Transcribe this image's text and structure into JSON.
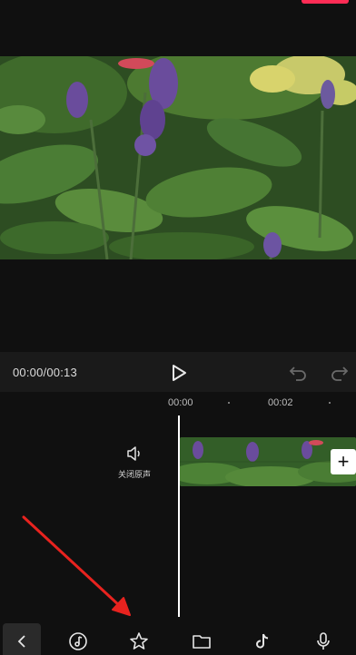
{
  "player": {
    "timecode": "00:00/00:13"
  },
  "timeline": {
    "ruler": [
      "00:00",
      "00:02"
    ],
    "mute_label": "关闭原声",
    "add_label": "+"
  },
  "toolbar": {
    "items": [
      "back",
      "music",
      "effects",
      "album",
      "tiktok",
      "voice"
    ]
  },
  "colors": {
    "accent": "#fe2c55",
    "background": "#101010",
    "control_bar": "#1a1a1a",
    "arrow": "#e8231f"
  }
}
